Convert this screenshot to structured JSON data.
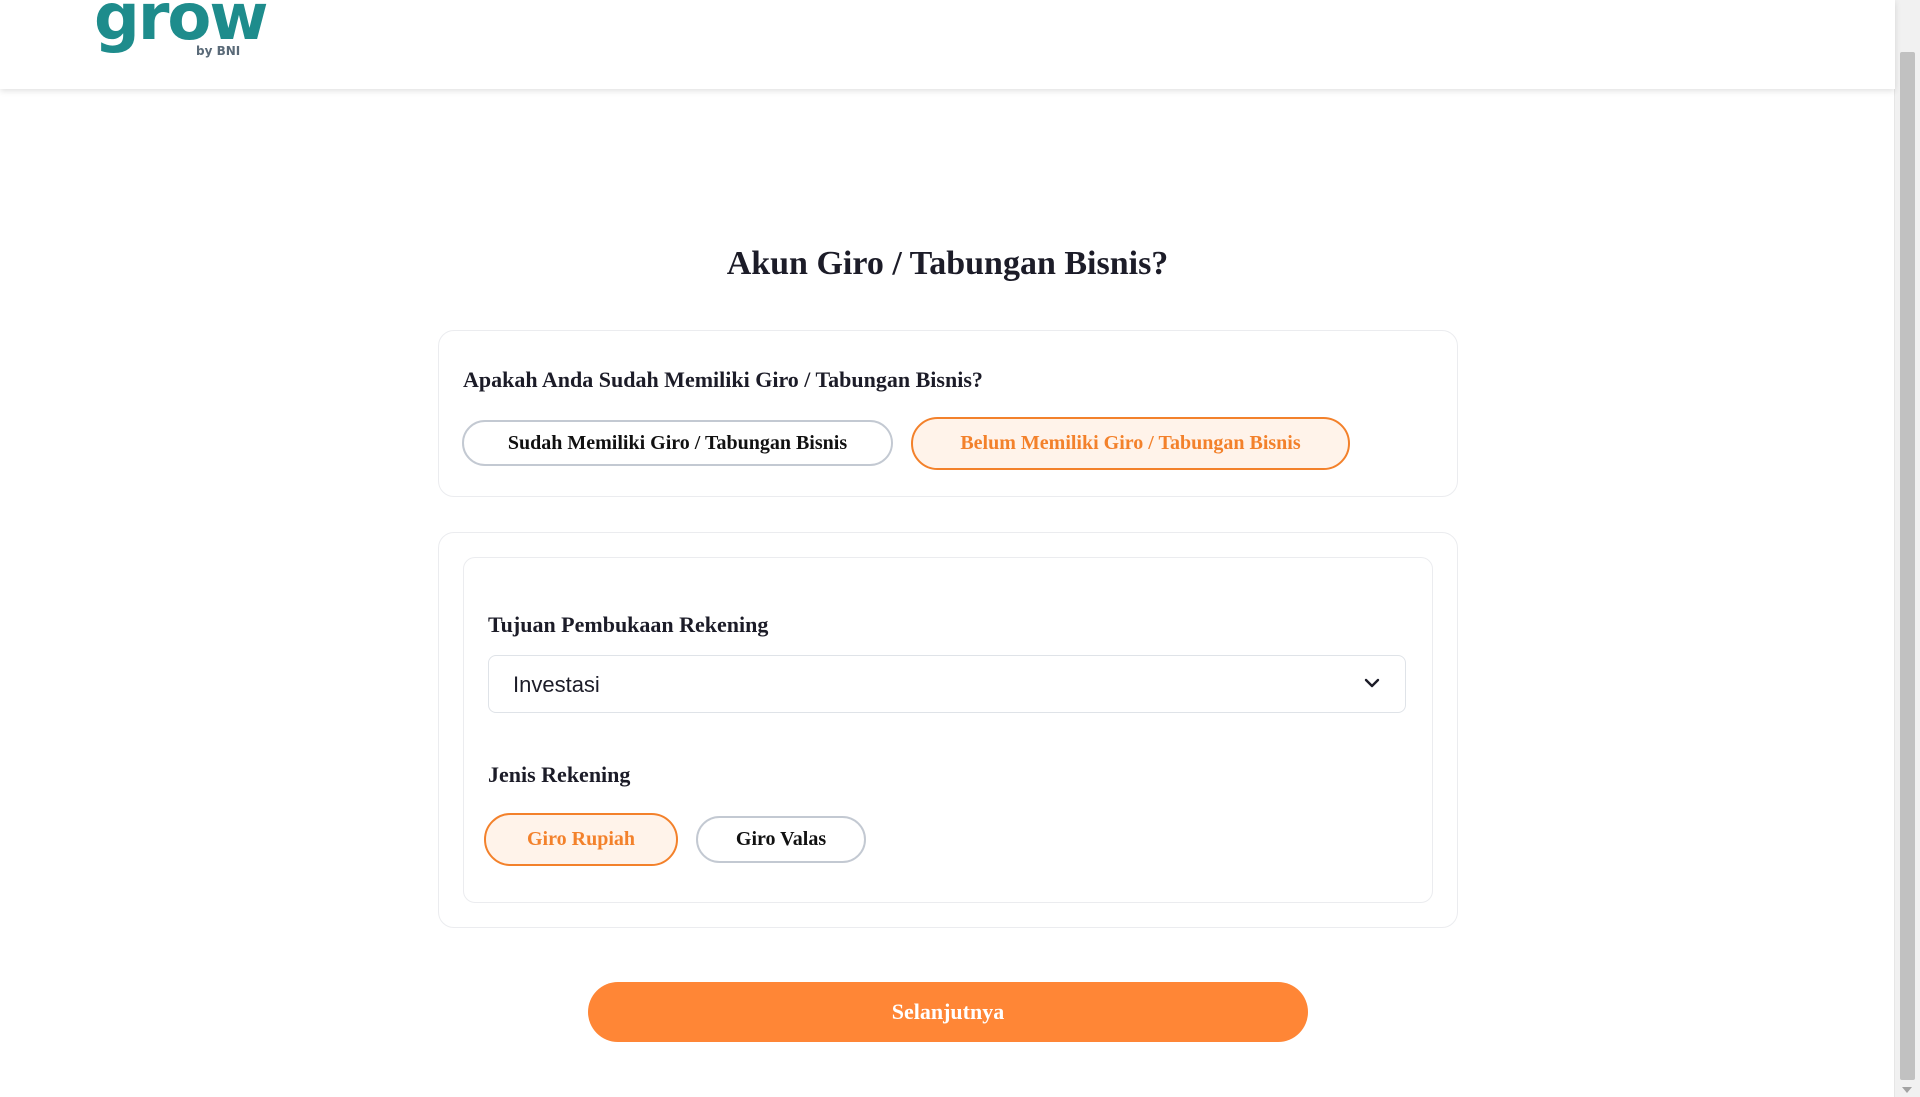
{
  "header": {
    "logo_text": "grow",
    "logo_sub": "by BNI",
    "brand_color": "#1e8c8c",
    "accent_color": "#f3812b"
  },
  "main": {
    "title": "Akun Giro / Tabungan Bisnis?",
    "question": {
      "text": "Apakah Anda Sudah Memiliki Giro / Tabungan Bisnis?",
      "options": [
        {
          "label": "Sudah Memiliki Giro / Tabungan Bisnis",
          "selected": false
        },
        {
          "label": "Belum Memiliki Giro / Tabungan Bisnis",
          "selected": true
        }
      ]
    },
    "form": {
      "tujuan_label": "Tujuan Pembukaan Rekening",
      "tujuan_value": "Investasi",
      "jenis_label": "Jenis Rekening",
      "jenis_options": [
        {
          "label": "Giro Rupiah",
          "selected": true
        },
        {
          "label": "Giro Valas",
          "selected": false
        }
      ]
    },
    "next_button": "Selanjutnya"
  },
  "icons": {
    "select_chevron": "chevron-down-icon"
  }
}
